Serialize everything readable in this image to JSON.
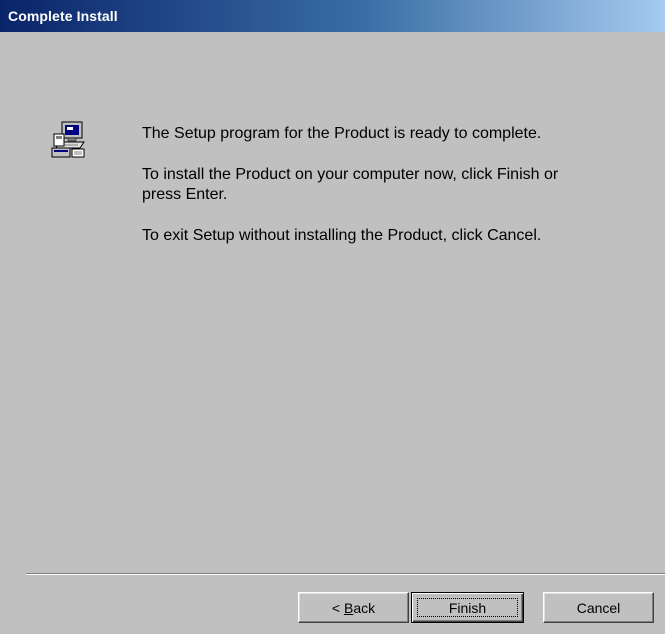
{
  "window": {
    "title": "Complete Install"
  },
  "content": {
    "icon": "setup-computer-icon",
    "paragraphs": [
      "The Setup program for the Product is ready to complete.",
      "To install the Product on your computer now, click Finish or press Enter.",
      "To exit Setup without installing the Product, click Cancel."
    ]
  },
  "buttons": {
    "back_prefix": "< ",
    "back_accel": "B",
    "back_rest": "ack",
    "finish_label": "Finish",
    "cancel_label": "Cancel"
  },
  "colors": {
    "face": "#c0c0c0",
    "title_start": "#0a246a",
    "title_end": "#a6caf0"
  }
}
